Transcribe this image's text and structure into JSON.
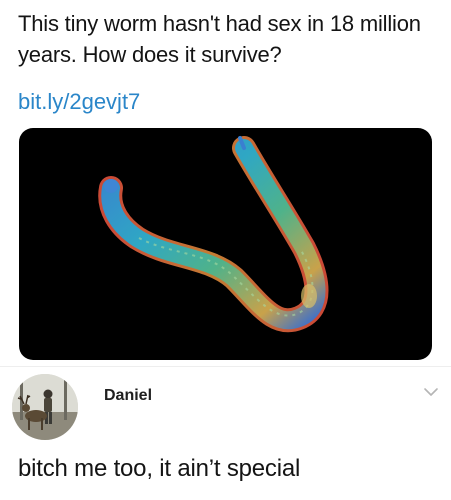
{
  "tweet": {
    "text": "This tiny worm hasn't had sex in 18 million years. How does it survive?",
    "link": "bit.ly/2gevjt7",
    "media": {
      "icon": "worm-image"
    }
  },
  "reply": {
    "username": "Daniel",
    "text": "bitch me too, it ain’t special",
    "avatar": {
      "icon": "avatar-deer-photo"
    },
    "menu": {
      "icon": "chevron-down-icon"
    }
  },
  "colors": {
    "link": "#2a86c9",
    "media_bg": "#000000"
  }
}
